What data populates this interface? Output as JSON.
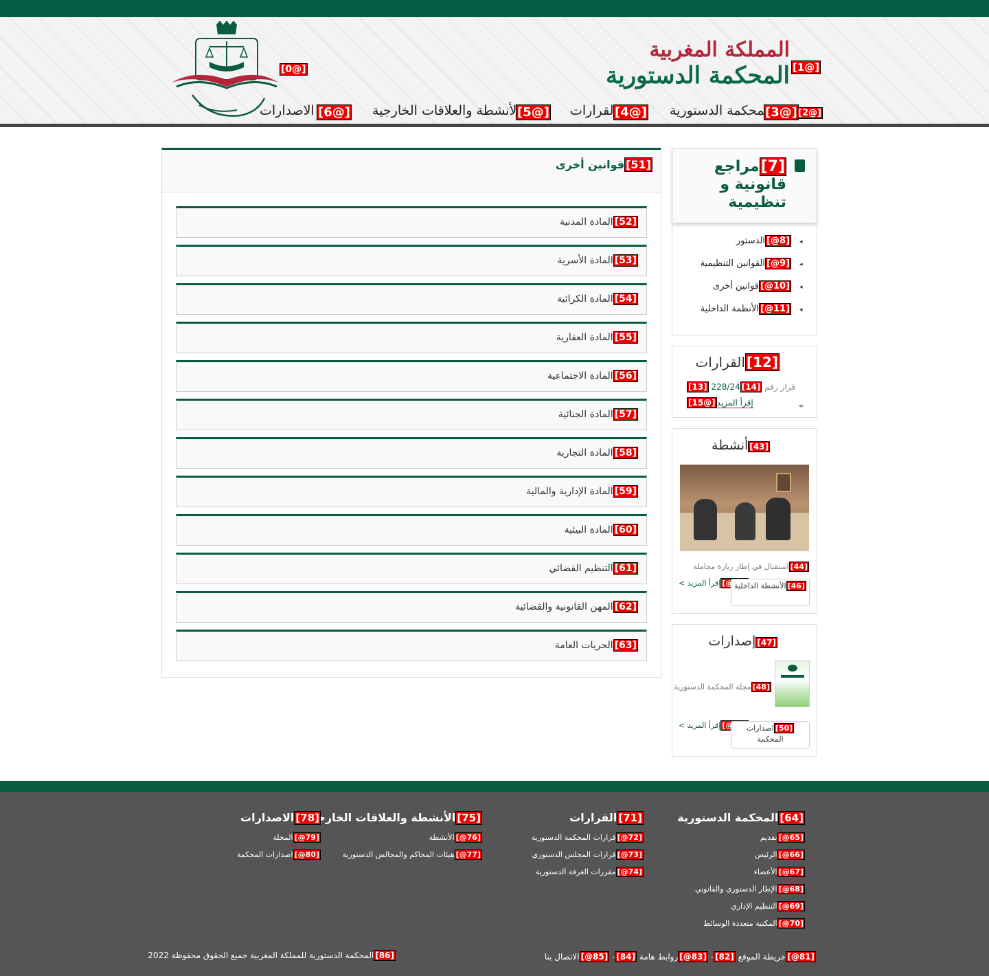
{
  "header": {
    "kingdom": "المملكة المغربية",
    "court": "المحكمة الدستورية",
    "logo_tag": "[0@]",
    "title_tag": "[1@]"
  },
  "nav": [
    {
      "tag": "[2@]",
      "tag2": "[3@]",
      "label": "المحكمة الدستورية"
    },
    {
      "tag": "[4@]",
      "label": "القرارات"
    },
    {
      "tag": "[5@]",
      "label": "الأنشطة والعلاقات الخارجية"
    },
    {
      "tag": "[6@]",
      "label": "الاصدارات"
    }
  ],
  "main": {
    "title_tag": "[51]",
    "title": "قوانين أخرى",
    "items": [
      {
        "tag": "[52]",
        "label": "المادة المدنية"
      },
      {
        "tag": "[53]",
        "label": "المادة الأسرية"
      },
      {
        "tag": "[54]",
        "label": "المادة الكرائية"
      },
      {
        "tag": "[55]",
        "label": "المادة العقارية"
      },
      {
        "tag": "[56]",
        "label": "المادة الاجتماعية"
      },
      {
        "tag": "[57]",
        "label": "المادة الجنائية"
      },
      {
        "tag": "[58]",
        "label": "المادة التجارية"
      },
      {
        "tag": "[59]",
        "label": "المادة الإدارية والمالية"
      },
      {
        "tag": "[60]",
        "label": "المادة البيئية"
      },
      {
        "tag": "[61]",
        "label": "التنظيم القضائي"
      },
      {
        "tag": "[62]",
        "label": "المهن القانونية والقضائية"
      },
      {
        "tag": "[63]",
        "label": "الحريات العامة"
      }
    ]
  },
  "sidebar": {
    "refs": {
      "tag": "[7]",
      "title": "مراجع قانونية و تنظيمية",
      "links": [
        {
          "tag": "[8@]",
          "label": "الدستور"
        },
        {
          "tag": "[9@]",
          "label": "القوانين التنظيمية"
        },
        {
          "tag": "[10@]",
          "label": "قوانين أخرى"
        },
        {
          "tag": "[11@]",
          "label": "الأنظمة الداخلية"
        }
      ]
    },
    "decisions": {
      "tag": "[12]",
      "title": "القرارات",
      "number_tag": "[14]",
      "number": "228/24",
      "label_tag": "[13]",
      "label": "قرار رقم",
      "more_tag": "[15@]",
      "more": "إقرأ المزيد"
    },
    "activities": {
      "tag": "[43]",
      "title": "أنشطة",
      "caption_tag": "[44]",
      "caption": "استقبال في إطار زيارة مجاملة",
      "more_tag": "[45@]",
      "more": "إقرأ المزيد >",
      "btn_tag": "[46]",
      "btn": "الأنشطة الداخلية"
    },
    "publications": {
      "tag": "[47]",
      "title": "إصدارات",
      "caption_tag": "[48]",
      "caption": "مجلة المحكمة الدستورية",
      "more_tag": "[49@]",
      "more": "إقرأ المزيد >",
      "btn_tag": "[50]",
      "btn": "اصدارات المحكمة"
    }
  },
  "footer": {
    "cols": [
      {
        "tag": "[64]",
        "title": "المحكمة الدستورية",
        "links": [
          {
            "tag": "[65@]",
            "label": "تقديم"
          },
          {
            "tag": "[66@]",
            "label": "الرئيس"
          },
          {
            "tag": "[67@]",
            "label": "الأعضاء"
          },
          {
            "tag": "[68@]",
            "label": "الإطار الدستوري والقانوني"
          },
          {
            "tag": "[69@]",
            "label": "التنظيم الإداري"
          },
          {
            "tag": "[70@]",
            "label": "المكتبة متعددة الوسائط"
          }
        ]
      },
      {
        "tag": "[71]",
        "title": "القرارات",
        "links": [
          {
            "tag": "[72@]",
            "label": "قرارات المحكمة الدستورية"
          },
          {
            "tag": "[73@]",
            "label": "قرارات المجلس الدستوري"
          },
          {
            "tag": "[74@]",
            "label": "مقررات الغرفة الدستورية"
          }
        ]
      },
      {
        "tag": "[75]",
        "title": "الأنشطة والعلاقات الخارجية",
        "links": [
          {
            "tag": "[76@]",
            "label": "الأنشطة"
          },
          {
            "tag": "[77@]",
            "label": "هيئات المحاكم والمجالس الدستورية"
          }
        ]
      },
      {
        "tag": "[78]",
        "title": "الاصدارات",
        "links": [
          {
            "tag": "[79@]",
            "label": "المجلة"
          },
          {
            "tag": "[80@]",
            "label": "اصدارات المحكمة"
          }
        ]
      }
    ],
    "bottom_links": [
      {
        "tag": "[81@]",
        "label": "خريطة الموقع"
      },
      {
        "tag": "[82]",
        "label": "-"
      },
      {
        "tag": "[83@]",
        "label": "روابط هامة"
      },
      {
        "tag": "[84]",
        "label": "-"
      },
      {
        "tag": "[85@]",
        "label": "الاتصال بنا"
      }
    ],
    "copyright_tag": "[86]",
    "copyright": "المحكمة الدستورية للمملكة المغربية جميع الحقوق محفوظة 2022"
  }
}
